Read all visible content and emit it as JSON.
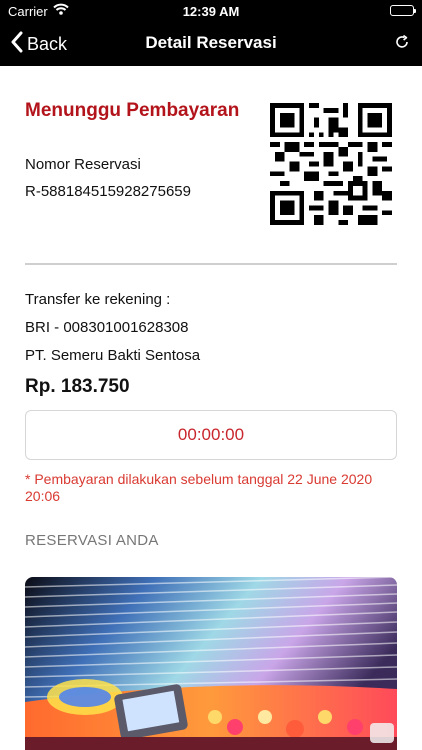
{
  "status_bar": {
    "carrier": "Carrier",
    "time": "12:39 AM"
  },
  "nav": {
    "back_label": "Back",
    "title": "Detail Reservasi"
  },
  "reservation": {
    "status": "Menunggu Pembayaran",
    "number_label": "Nomor Reservasi",
    "number": "R-588184515928275659"
  },
  "payment": {
    "transfer_label": "Transfer ke rekening :",
    "account": "BRI - 008301001628308",
    "account_holder": "PT. Semeru Bakti Sentosa",
    "amount": "Rp. 183.750",
    "countdown": "00:00:00",
    "deadline_note": "* Pembayaran dilakukan sebelum tanggal 22 June 2020 20:06"
  },
  "section_title": "RESERVASI ANDA",
  "colors": {
    "accent": "#b3141b",
    "countdown": "#c8262c",
    "note": "#d93a32",
    "header": "#000000"
  },
  "icons": {
    "back": "chevron-left-icon",
    "refresh": "refresh-icon",
    "wifi": "wifi-icon",
    "battery": "battery-icon"
  }
}
